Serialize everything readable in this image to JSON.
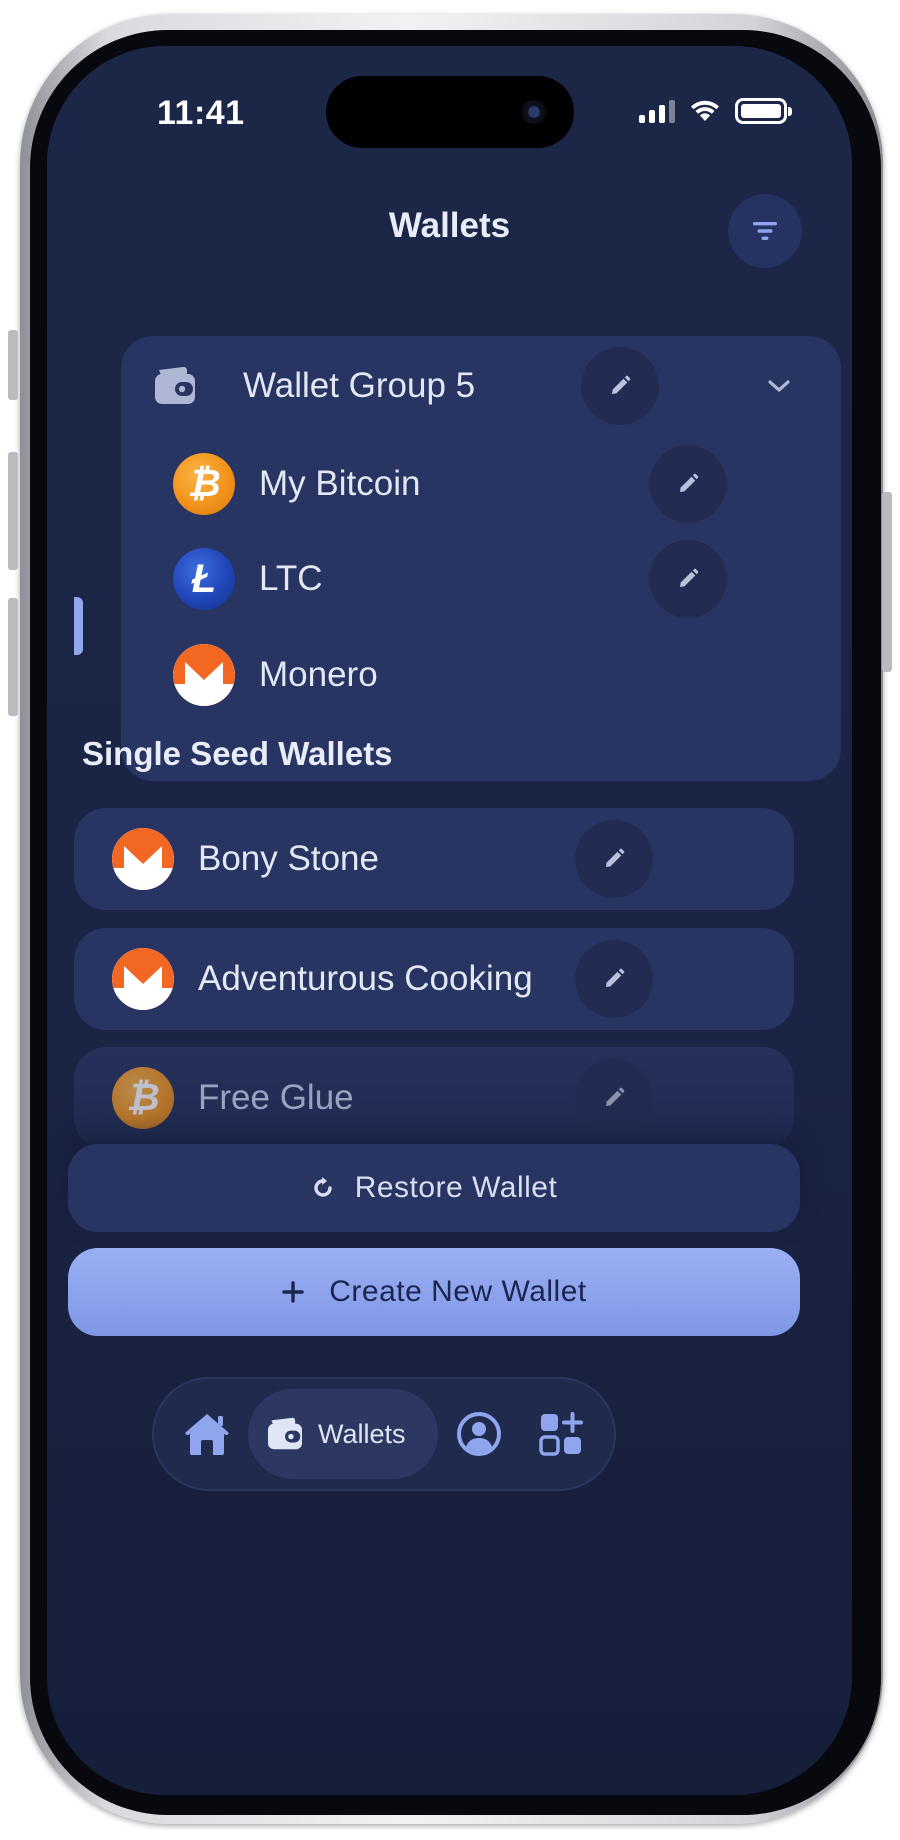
{
  "status_bar": {
    "time": "11:41"
  },
  "header": {
    "title": "Wallets"
  },
  "group": {
    "name": "Wallet Group 5",
    "wallets": [
      {
        "name": "My Bitcoin",
        "coin": "bitcoin",
        "editable": true
      },
      {
        "name": "LTC",
        "coin": "litecoin",
        "editable": true
      },
      {
        "name": "Monero",
        "coin": "monero",
        "editable": false,
        "active": true
      }
    ]
  },
  "single_seed": {
    "title": "Single Seed Wallets",
    "wallets": [
      {
        "name": "Bony Stone",
        "coin": "monero"
      },
      {
        "name": "Adventurous Cooking",
        "coin": "monero"
      },
      {
        "name": "Free Glue",
        "coin": "bitcoin"
      }
    ]
  },
  "actions": {
    "restore": "Restore Wallet",
    "create": "Create New Wallet"
  },
  "tabbar": {
    "wallets_label": "Wallets"
  },
  "colors": {
    "accent": "#8fa6ee",
    "card": "#283461",
    "background": "#1c2748"
  }
}
